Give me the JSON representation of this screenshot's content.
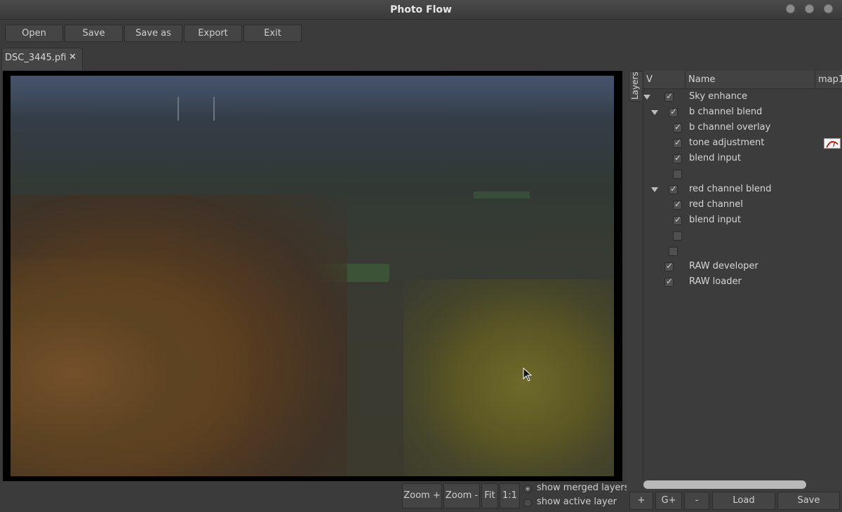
{
  "window": {
    "title": "Photo Flow"
  },
  "toolbar": {
    "open": "Open",
    "save": "Save",
    "save_as": "Save as",
    "export": "Export",
    "exit": "Exit"
  },
  "tabs": [
    {
      "label": "DSC_3445.pfi",
      "close_icon": "close-icon"
    }
  ],
  "viewer": {
    "zoom_in": "Zoom +",
    "zoom_out": "Zoom -",
    "fit": "Fit",
    "one_to_one": "1:1",
    "show_merged": "show merged layers",
    "show_active": "show active layer",
    "selected_mode": "show merged layers"
  },
  "layers_panel": {
    "tab_label": "Layers",
    "columns": {
      "visible": "V",
      "name": "Name",
      "map": "map1"
    },
    "rows": [
      {
        "name": "Sky enhance",
        "checked": true,
        "expanded": true
      },
      {
        "name": "b channel blend",
        "checked": true,
        "expanded": true
      },
      {
        "name": "b channel overlay",
        "checked": true
      },
      {
        "name": "tone adjustment",
        "checked": true,
        "map_icon": "curve-thumbnail-icon"
      },
      {
        "name": "blend input",
        "checked": true
      },
      {
        "name": "",
        "checked": false
      },
      {
        "name": "red channel blend",
        "checked": true,
        "expanded": true
      },
      {
        "name": "red channel",
        "checked": true
      },
      {
        "name": "blend input",
        "checked": true
      },
      {
        "name": "",
        "checked": false
      },
      {
        "name": "",
        "checked": false
      },
      {
        "name": "RAW developer",
        "checked": true
      },
      {
        "name": "RAW loader",
        "checked": true
      }
    ],
    "buttons": {
      "add": "+",
      "add_group": "G+",
      "remove": "-",
      "load": "Load",
      "save": "Save"
    }
  },
  "colors": {
    "background": "#3b3b3b",
    "button": "#444444",
    "viewer_bg": "#000000"
  }
}
